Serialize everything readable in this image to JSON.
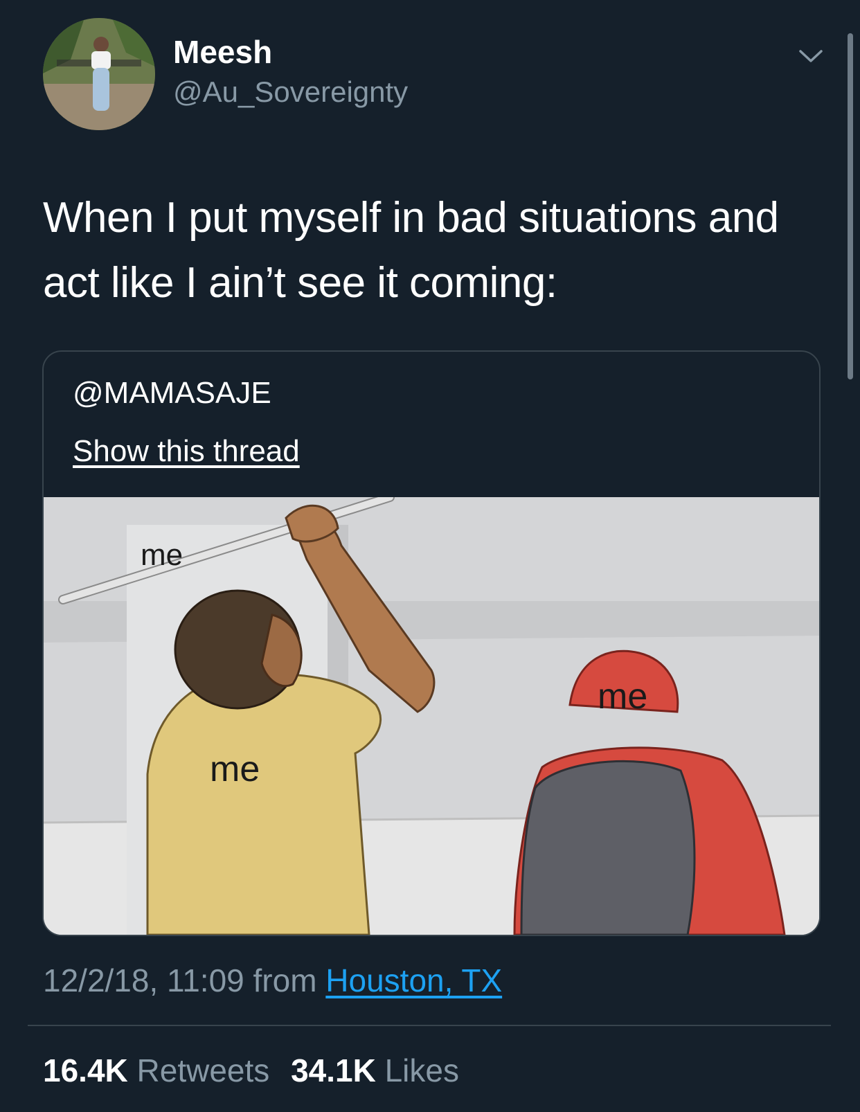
{
  "colors": {
    "background": "#15202b",
    "text_primary": "#ffffff",
    "text_secondary": "#8899a6",
    "link": "#1da1f2",
    "border": "#38444d"
  },
  "author": {
    "display_name": "Meesh",
    "handle": "@Au_Sovereignty",
    "avatar_icon": "profile-photo"
  },
  "tweet": {
    "text": "When I put myself in bad situations and act like I ain’t see it coming:"
  },
  "quoted_tweet": {
    "author_handle": "@MAMASAJE",
    "show_thread_label": "Show this thread",
    "image_labels": {
      "stick": "me",
      "attacker": "me",
      "victim": "me"
    }
  },
  "meta": {
    "timestamp": "12/2/18, 11:09",
    "from_word": "from",
    "location": "Houston, TX"
  },
  "stats": {
    "retweets_count": "16.4K",
    "retweets_label": "Retweets",
    "likes_count": "34.1K",
    "likes_label": "Likes"
  }
}
